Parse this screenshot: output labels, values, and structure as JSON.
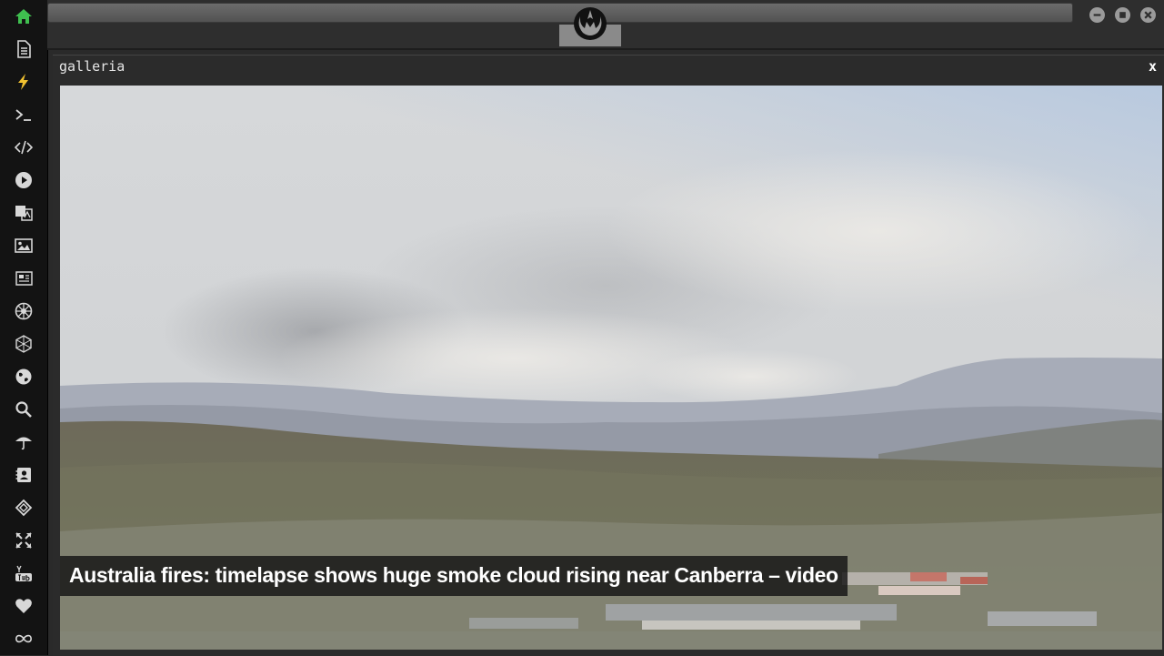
{
  "window": {
    "title": "galleria",
    "close_label": "x"
  },
  "gallery": {
    "caption": "Australia fires: timelapse shows huge smoke cloud rising near Canberra – video"
  },
  "sidebar": {
    "items": [
      {
        "icon": "home-icon",
        "color": "#3fbf4f"
      },
      {
        "icon": "document-icon",
        "color": "#d8d8d8"
      },
      {
        "icon": "lightning-icon",
        "color": "#f2c230"
      },
      {
        "icon": "terminal-icon",
        "color": "#d8d8d8"
      },
      {
        "icon": "code-icon",
        "color": "#d8d8d8"
      },
      {
        "icon": "play-icon",
        "color": "#d8d8d8"
      },
      {
        "icon": "translate-icon",
        "color": "#d8d8d8"
      },
      {
        "icon": "image-icon",
        "color": "#d8d8d8"
      },
      {
        "icon": "newspaper-icon",
        "color": "#d8d8d8"
      },
      {
        "icon": "empire-icon",
        "color": "#d8d8d8"
      },
      {
        "icon": "hexagon-icon",
        "color": "#d8d8d8"
      },
      {
        "icon": "globe-icon",
        "color": "#d8d8d8"
      },
      {
        "icon": "search-icon",
        "color": "#d8d8d8"
      },
      {
        "icon": "umbrella-icon",
        "color": "#d8d8d8"
      },
      {
        "icon": "contact-card-icon",
        "color": "#d8d8d8"
      },
      {
        "icon": "codepen-icon",
        "color": "#d8d8d8"
      },
      {
        "icon": "expand-icon",
        "color": "#d8d8d8"
      },
      {
        "icon": "youtube-icon",
        "color": "#d8d8d8"
      },
      {
        "icon": "heart-icon",
        "color": "#d8d8d8"
      },
      {
        "icon": "infinity-icon",
        "color": "#d8d8d8"
      }
    ]
  },
  "toolbar": {
    "logo": "rebel-alliance-icon",
    "window_buttons": [
      "minimize-icon",
      "maximize-icon",
      "close-icon"
    ]
  }
}
